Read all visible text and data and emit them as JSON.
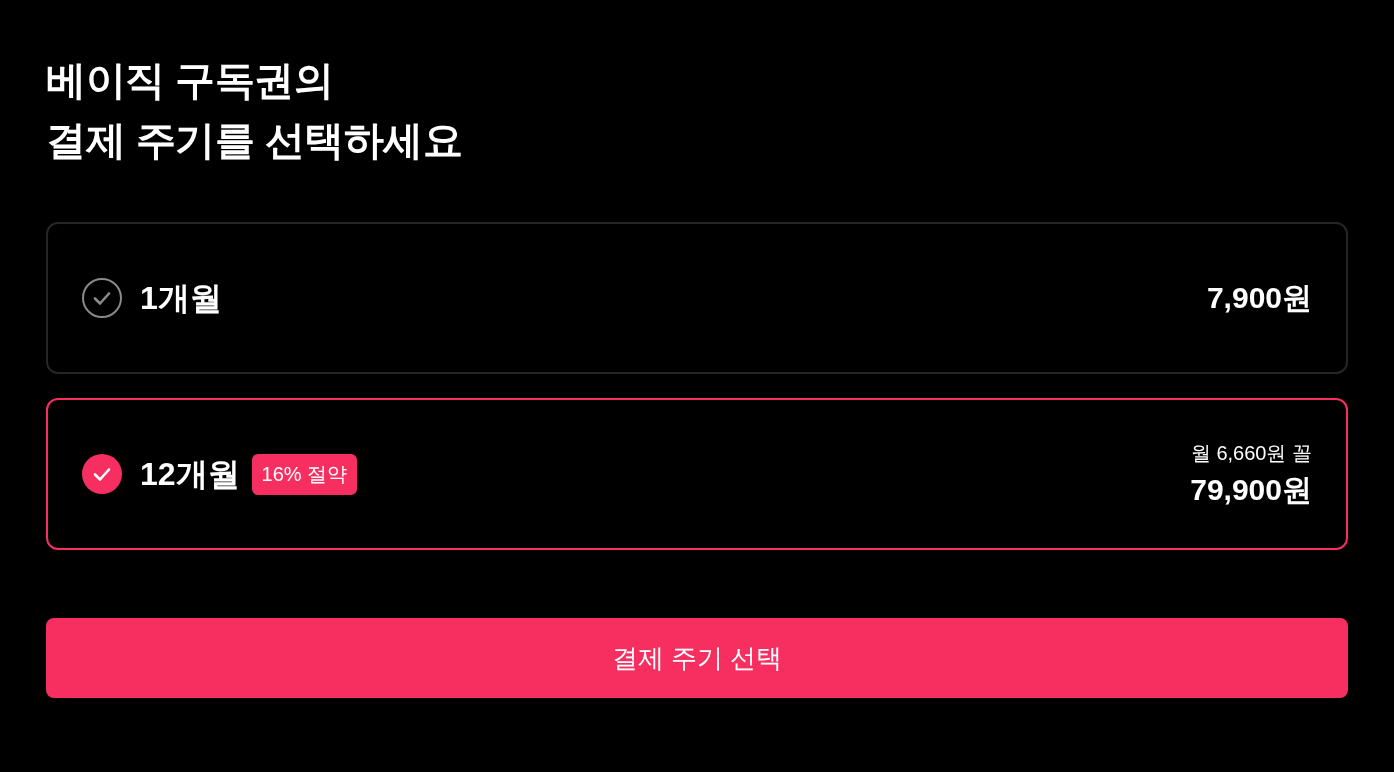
{
  "title_lines": [
    "베이직 구독권의",
    "결제 주기를 선택하세요"
  ],
  "plans": [
    {
      "name": "1개월",
      "selected": false,
      "price": "7,900원"
    },
    {
      "name": "12개월",
      "selected": true,
      "badge": "16% 절약",
      "monthly_note": "월 6,660원 꼴",
      "price": "79,900원"
    }
  ],
  "submit_button": {
    "label": "결제 주기 선택"
  }
}
